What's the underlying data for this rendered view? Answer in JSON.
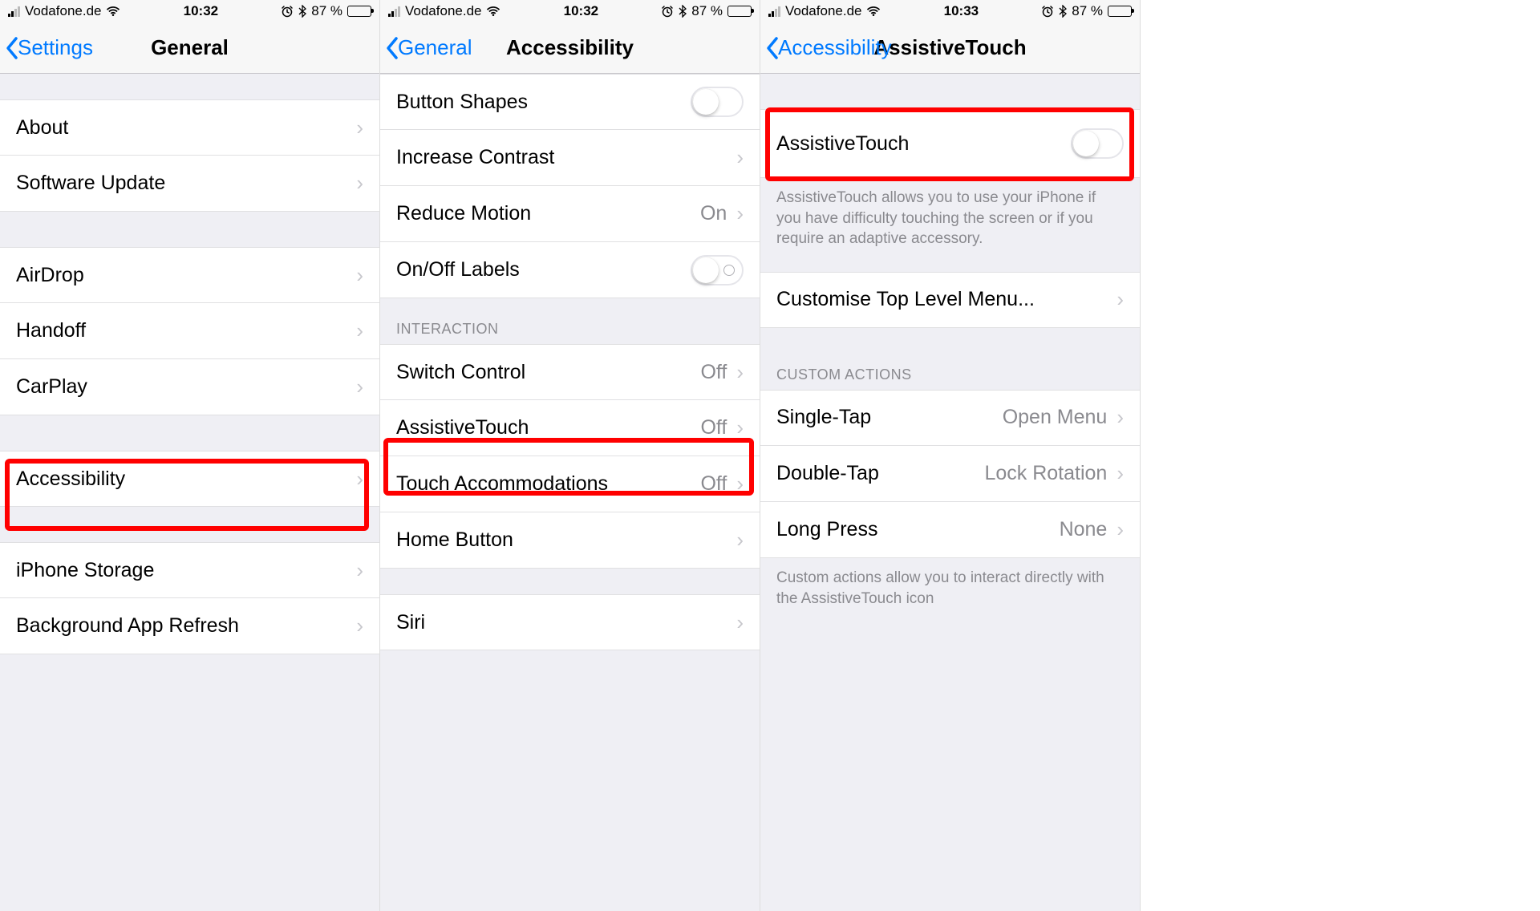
{
  "status": {
    "carrier": "Vodafone.de",
    "time1": "10:32",
    "time2": "10:32",
    "time3": "10:33",
    "battery_pct": "87 %"
  },
  "screen1": {
    "back": "Settings",
    "title": "General",
    "rows": {
      "about": "About",
      "software_update": "Software Update",
      "airdrop": "AirDrop",
      "handoff": "Handoff",
      "carplay": "CarPlay",
      "accessibility": "Accessibility",
      "iphone_storage": "iPhone Storage",
      "bg_refresh": "Background App Refresh"
    }
  },
  "screen2": {
    "back": "General",
    "title": "Accessibility",
    "rows": {
      "button_shapes": "Button Shapes",
      "increase_contrast": "Increase Contrast",
      "reduce_motion": "Reduce Motion",
      "reduce_motion_value": "On",
      "onoff_labels": "On/Off Labels",
      "section_interaction": "INTERACTION",
      "switch_control": "Switch Control",
      "switch_control_value": "Off",
      "assistive_touch": "AssistiveTouch",
      "assistive_touch_value": "Off",
      "touch_accom": "Touch Accommodations",
      "touch_accom_value": "Off",
      "home_button": "Home Button",
      "siri": "Siri"
    }
  },
  "screen3": {
    "back": "Accessibility",
    "title": "AssistiveTouch",
    "rows": {
      "assistive_touch": "AssistiveTouch",
      "footer1": "AssistiveTouch allows you to use your iPhone if you have difficulty touching the screen or if you require an adaptive accessory.",
      "customise": "Customise Top Level Menu...",
      "section_custom": "CUSTOM ACTIONS",
      "single_tap": "Single-Tap",
      "single_tap_value": "Open Menu",
      "double_tap": "Double-Tap",
      "double_tap_value": "Lock Rotation",
      "long_press": "Long Press",
      "long_press_value": "None",
      "footer2": "Custom actions allow you to interact directly with the AssistiveTouch icon"
    }
  }
}
